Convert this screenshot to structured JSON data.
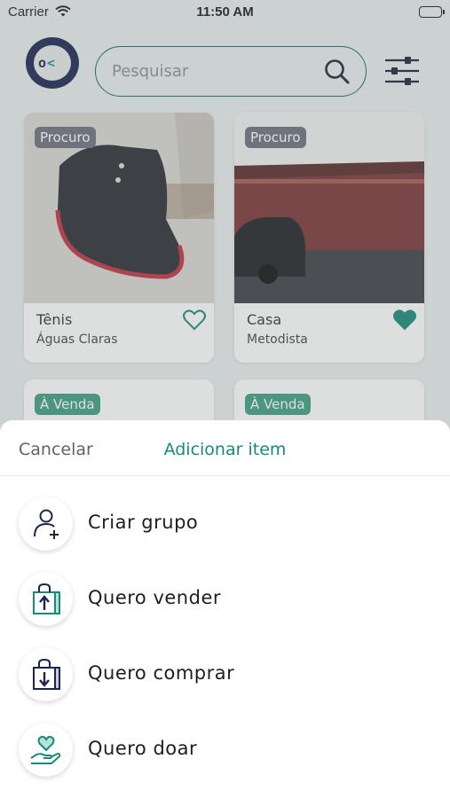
{
  "status_bar": {
    "carrier": "Carrier",
    "time": "11:50 AM"
  },
  "search": {
    "placeholder": "Pesquisar"
  },
  "cards": [
    {
      "badge": "Procuro",
      "title": "Tênis",
      "location": "Águas Claras",
      "favorited": false
    },
    {
      "badge": "Procuro",
      "title": "Casa",
      "location": "Metodista",
      "favorited": true
    },
    {
      "badge": "À Venda"
    },
    {
      "badge": "À Venda"
    }
  ],
  "sheet": {
    "cancel_label": "Cancelar",
    "title": "Adicionar item",
    "options": [
      {
        "label": "Criar grupo",
        "icon": "add-user-icon"
      },
      {
        "label": "Quero vender",
        "icon": "shopping-bag-up-icon"
      },
      {
        "label": "Quero comprar",
        "icon": "shopping-bag-down-icon"
      },
      {
        "label": "Quero doar",
        "icon": "heart-hand-icon"
      }
    ]
  },
  "colors": {
    "brand_navy": "#1c2450",
    "accent_teal": "#178a79",
    "badge_procuro": "#6d6f7d",
    "badge_venda": "#3e9c80"
  }
}
